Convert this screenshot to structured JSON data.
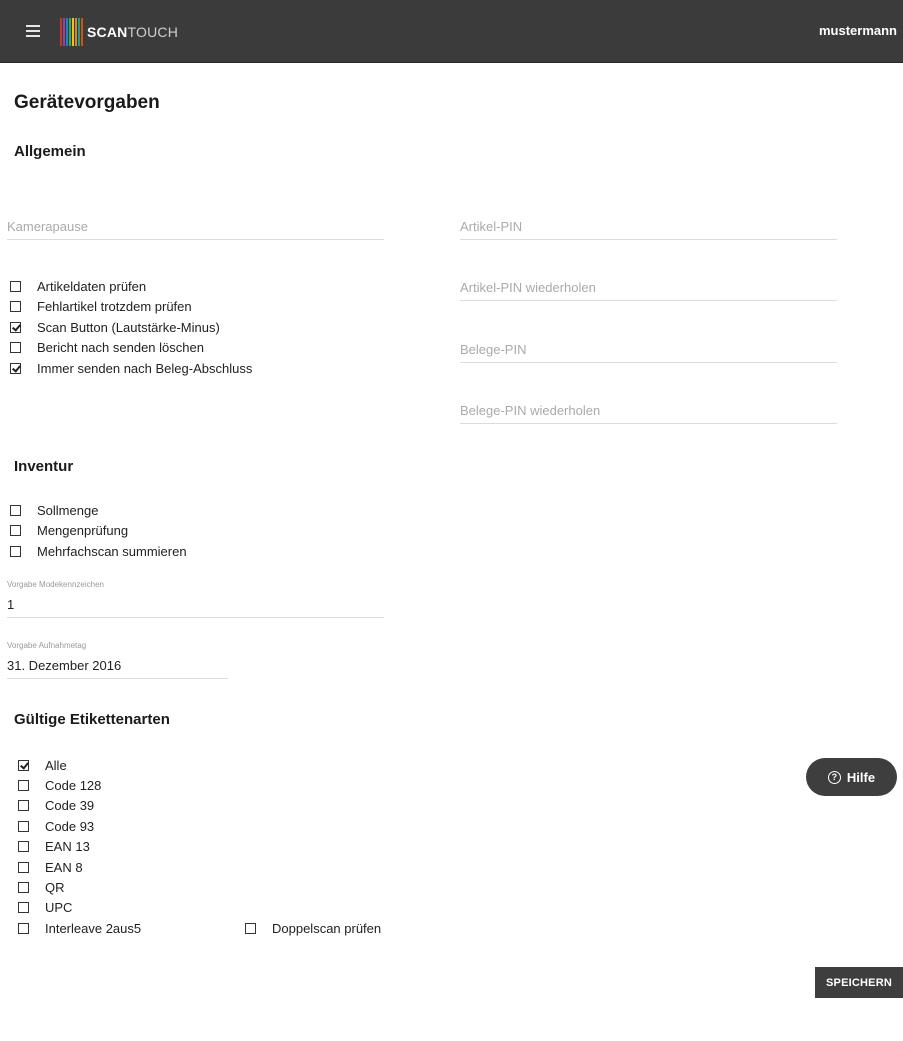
{
  "header": {
    "menu_icon": "hamburger-icon",
    "logo_bold": "SCAN",
    "logo_light": "TOUCH",
    "logo_colors": [
      "#c0392b",
      "#8e44ad",
      "#2980b9",
      "#27ae60",
      "#f1c40f",
      "#e67e22",
      "#16a085",
      "#d35400"
    ],
    "username": "mustermann"
  },
  "page_title": "Gerätevorgaben",
  "allgemein": {
    "title": "Allgemein",
    "kamerapause_placeholder": "Kamerapause",
    "checkboxes": [
      {
        "label": "Artikeldaten prüfen",
        "checked": false
      },
      {
        "label": "Fehlartikel trotzdem prüfen",
        "checked": false
      },
      {
        "label": "Scan Button (Lautstärke-Minus)",
        "checked": true
      },
      {
        "label": "Bericht nach senden löschen",
        "checked": false
      },
      {
        "label": "Immer senden nach Beleg-Abschluss",
        "checked": true
      }
    ],
    "pins": {
      "artikel_pin": "Artikel-PIN",
      "artikel_pin_repeat": "Artikel-PIN wiederholen",
      "belege_pin": "Belege-PIN",
      "belege_pin_repeat": "Belege-PIN wiederholen"
    }
  },
  "inventur": {
    "title": "Inventur",
    "checkboxes": [
      {
        "label": "Sollmenge",
        "checked": false
      },
      {
        "label": "Mengenprüfung",
        "checked": false
      },
      {
        "label": "Mehrfachscan summieren",
        "checked": false
      }
    ],
    "modekennzeichen_label": "Vorgabe Modekennzeichen",
    "modekennzeichen_value": "1",
    "aufnahmetag_label": "Vorgabe Aufnahmetag",
    "aufnahmetag_value": "31. Dezember 2016"
  },
  "etiketten": {
    "title": "Gültige Etikettenarten",
    "checkboxes": [
      {
        "label": "Alle",
        "checked": true
      },
      {
        "label": "Code 128",
        "checked": false
      },
      {
        "label": "Code 39",
        "checked": false
      },
      {
        "label": "Code 93",
        "checked": false
      },
      {
        "label": "EAN 13",
        "checked": false
      },
      {
        "label": "EAN 8",
        "checked": false
      },
      {
        "label": "QR",
        "checked": false
      },
      {
        "label": "UPC",
        "checked": false
      },
      {
        "label": "Interleave 2aus5",
        "checked": false
      }
    ],
    "doppelscan": {
      "label": "Doppelscan prüfen",
      "checked": false
    }
  },
  "help_button": {
    "label": "Hilfe",
    "icon": "question-circle-icon"
  },
  "save_button": "SPEICHERN"
}
